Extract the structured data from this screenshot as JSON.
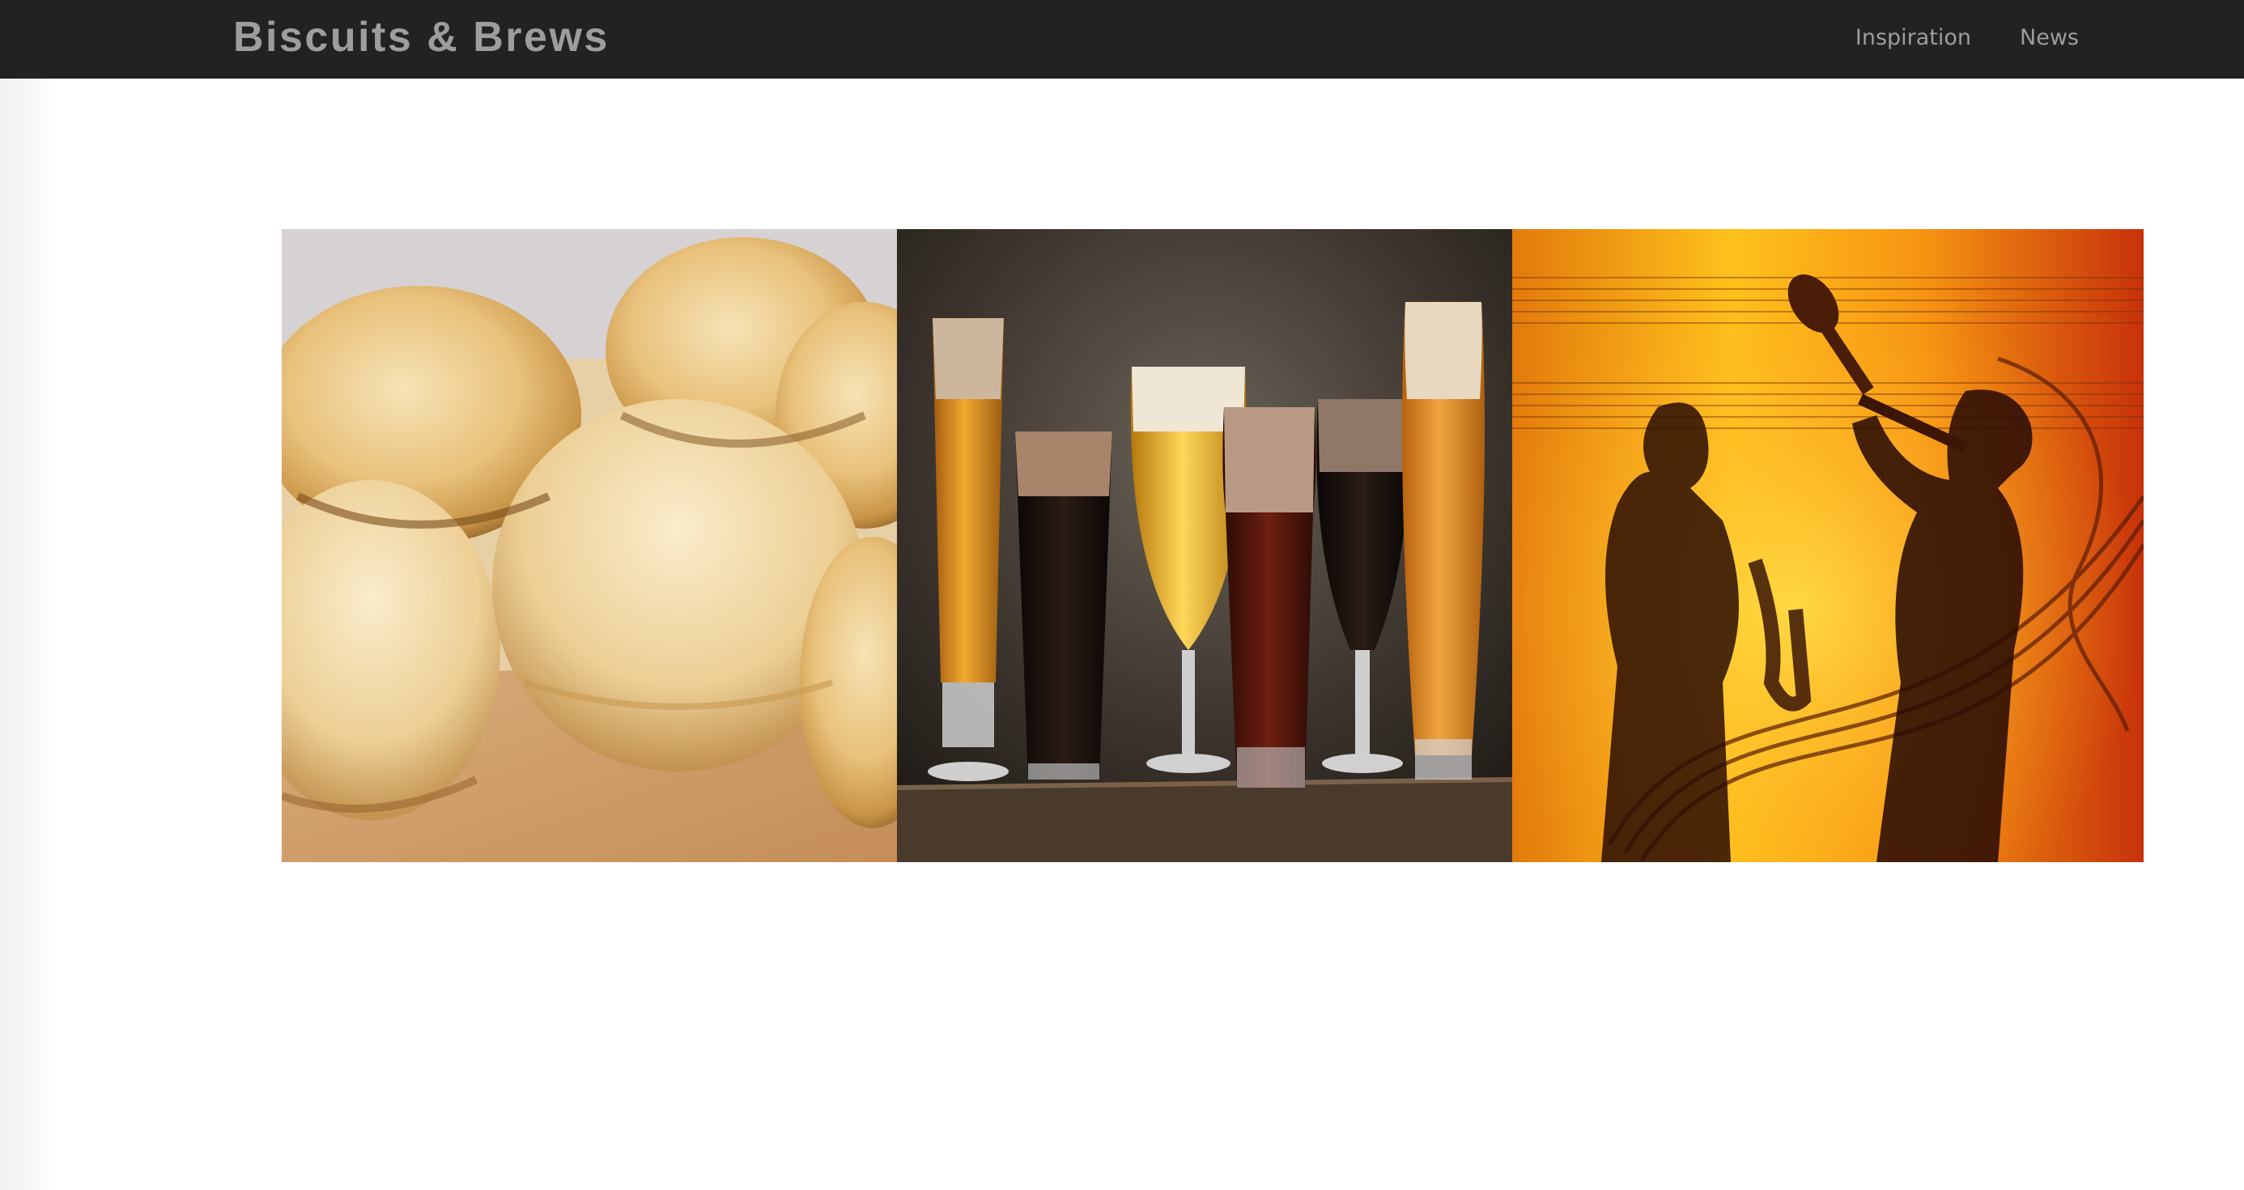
{
  "navbar": {
    "brand": "Biscuits & Brews",
    "links": [
      {
        "label": "Inspiration"
      },
      {
        "label": "News"
      }
    ]
  },
  "gallery": {
    "images": [
      {
        "subject": "biscuits-image"
      },
      {
        "subject": "beer-glasses-image"
      },
      {
        "subject": "jazz-musicians-image"
      }
    ]
  },
  "colors": {
    "navbar_bg": "#222222",
    "nav_text": "#9d9d9d",
    "page_bg": "#ffffff"
  }
}
